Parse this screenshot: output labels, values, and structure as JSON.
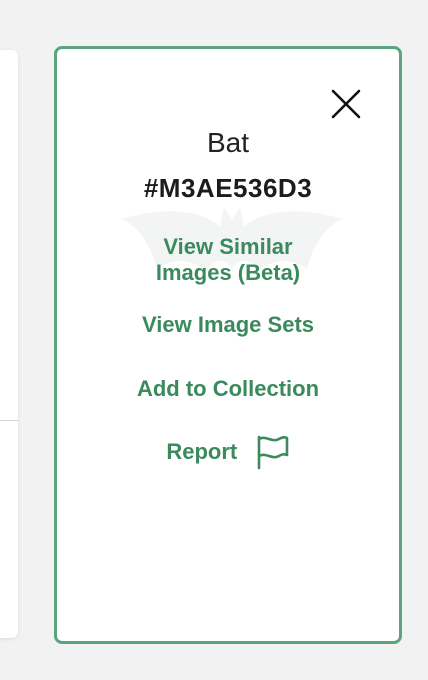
{
  "panel": {
    "title": "Bat",
    "code": "#M3AE536D3",
    "actions": {
      "view_similar_line1": "View Similar",
      "view_similar_line2": "Images (Beta)",
      "view_sets": "View Image Sets",
      "add_collection": "Add to Collection",
      "report": "Report"
    },
    "icons": {
      "close": "close-icon",
      "report": "flag-icon",
      "watermark": "bat-watermark"
    }
  },
  "colors": {
    "accent": "#5aa57f",
    "link": "#3a8a5e",
    "text": "#222222",
    "background": "#f2f2f2"
  }
}
